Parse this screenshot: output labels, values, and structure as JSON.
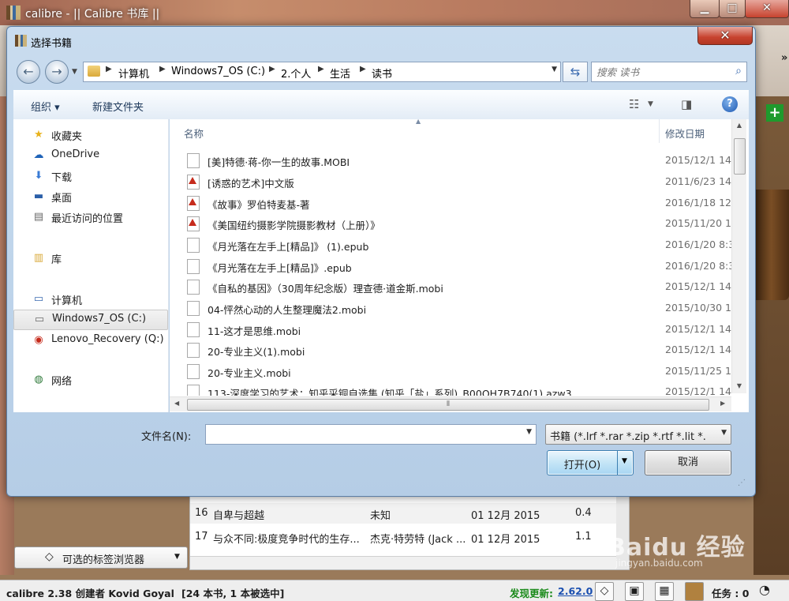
{
  "background_app": {
    "title": "calibre - || Calibre 书库 ||",
    "window_buttons": {
      "minimize": "▁",
      "maximize": "□",
      "close": "✕"
    },
    "toolbar_more": "»",
    "book_rows": [
      {
        "num": "16",
        "title": "自卑与超越",
        "author": "未知",
        "date": "01 12月 2015",
        "size": "0.4"
      },
      {
        "num": "17",
        "title": "与众不同:极度竞争时代的生存...",
        "author": "杰克·特劳特 (Jack ...",
        "date": "01 12月 2015",
        "size": "1.1"
      }
    ],
    "tag_browser_button": "可选的标签浏览器",
    "status": {
      "version": "calibre 2.38 创建者 Kovid Goyal",
      "counts": "[24 本书, 1 本被选中]",
      "update_label": "发现更新:",
      "update_version": "2.62.0",
      "jobs": "任务 : 0"
    },
    "watermark": "Baidu 经验",
    "watermark_url": "jingyan.baidu.com"
  },
  "dialog": {
    "title": "选择书籍",
    "close_glyph": "✕",
    "breadcrumb": [
      "计算机",
      "Windows7_OS (C:)",
      "2.个人",
      "生活",
      "读书"
    ],
    "search_placeholder": "搜索 读书",
    "commands": {
      "organize": "组织 ▾",
      "new_folder": "新建文件夹"
    },
    "nav": {
      "favorites": "收藏夹",
      "onedrive": "OneDrive",
      "downloads": "下载",
      "desktop": "桌面",
      "recent": "最近访问的位置",
      "libraries": "库",
      "computer": "计算机",
      "drive_c": "Windows7_OS (C:)",
      "drive_q": "Lenovo_Recovery (Q:)",
      "network": "网络"
    },
    "columns": {
      "name": "名称",
      "modified": "修改日期"
    },
    "files": [
      {
        "name": "[美]特德·蒋-你一生的故事.MOBI",
        "date": "2015/12/1 14",
        "icon": "doc"
      },
      {
        "name": "[诱惑的艺术]中文版",
        "date": "2011/6/23 14",
        "icon": "pdf"
      },
      {
        "name": "《故事》罗伯特麦基-著",
        "date": "2016/1/18 12",
        "icon": "pdf"
      },
      {
        "name": "《美国纽约摄影学院摄影教材（上册）》",
        "date": "2015/11/20 1",
        "icon": "pdf"
      },
      {
        "name": "《月光落在左手上[精品]》 (1).epub",
        "date": "2016/1/20 8:3",
        "icon": "doc"
      },
      {
        "name": "《月光落在左手上[精品]》.epub",
        "date": "2016/1/20 8:3",
        "icon": "doc"
      },
      {
        "name": "《自私的基因》（30周年纪念版）理查德·道金斯.mobi",
        "date": "2015/12/1 14",
        "icon": "doc"
      },
      {
        "name": "04-怦然心动的人生整理魔法2.mobi",
        "date": "2015/10/30 1",
        "icon": "doc"
      },
      {
        "name": "11-这才是思维.mobi",
        "date": "2015/12/1 14",
        "icon": "doc"
      },
      {
        "name": "20-专业主义(1).mobi",
        "date": "2015/12/1 14",
        "icon": "doc"
      },
      {
        "name": "20-专业主义.mobi",
        "date": "2015/11/25 1",
        "icon": "doc"
      },
      {
        "name": "113-深度学习的艺术：知乎采铜自选集 (知乎「盐」系列)_B00OH7B740(1).azw3",
        "date": "2015/12/1 14",
        "icon": "doc"
      }
    ],
    "filename_label": "文件名(N):",
    "filename_value": "",
    "filetype_value": "书籍 (*.lrf *.rar *.zip *.rtf *.lit *.",
    "open_button": "打开(O)",
    "cancel_button": "取消"
  }
}
